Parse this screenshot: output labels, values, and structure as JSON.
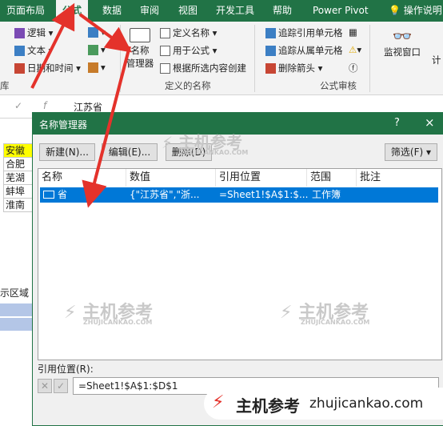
{
  "ribbon": {
    "tabs": [
      "页面布局",
      "公式",
      "数据",
      "审阅",
      "视图",
      "开发工具",
      "帮助",
      "Power Pivot",
      "操作说明"
    ],
    "items": {
      "logic": "逻辑",
      "text": "文本",
      "datetime": "日期和时间",
      "name_manager": [
        "名称",
        "管理器"
      ],
      "define_name": "定义名称",
      "use_in_formula": "用于公式",
      "create_from_selection": "根据所选内容创建",
      "trace_precedents": "追踪引用单元格",
      "trace_dependents": "追踪从属单元格",
      "remove_arrows": "删除箭头",
      "watch_window": "监视窗口",
      "calc": "计"
    },
    "groups": {
      "library": "库",
      "defined_names": "定义的名称",
      "auditing": "公式审核"
    }
  },
  "sheet": {
    "formula_bar_text": "江苏省",
    "cells": [
      "安徽",
      "合肥",
      "芜湖",
      "蚌埠",
      "淮南"
    ],
    "side_label": "示区域"
  },
  "dialog": {
    "title": "名称管理器",
    "help": "?",
    "close": "×",
    "buttons": {
      "new": "新建(N)...",
      "edit": "编辑(E)...",
      "delete": "删除(D)",
      "filter": "筛选(F)"
    },
    "columns": [
      "名称",
      "数值",
      "引用位置",
      "范围",
      "批注"
    ],
    "rows": [
      {
        "name": "省",
        "value": "{\"江苏省\",\"浙...",
        "ref": "=Sheet1!$A$1:$...",
        "scope": "工作簿",
        "comment": ""
      }
    ],
    "ref_label": "引用位置(R):",
    "ref_value": "=Sheet1!$A$1:$D$1"
  },
  "watermark": {
    "brand": "主机参考",
    "domain": "zhujicankao.com",
    "pinyin": "ZHUJICANKAO.COM"
  },
  "colors": {
    "excel_green": "#217346",
    "selection_blue": "#0078d7",
    "arrow_red": "#e4322b"
  }
}
